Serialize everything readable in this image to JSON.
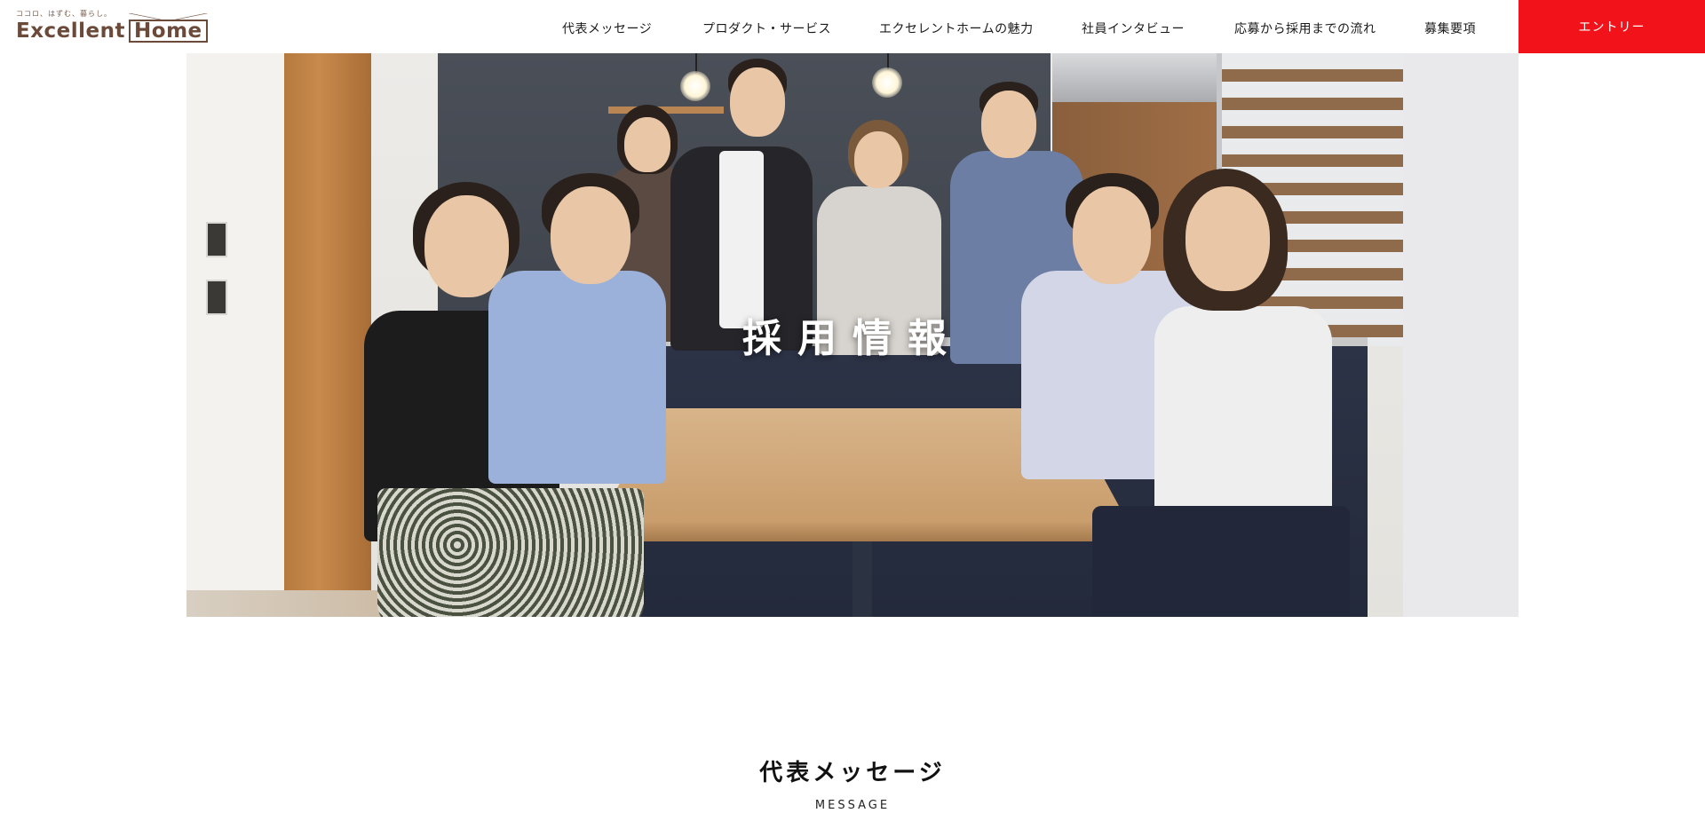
{
  "header": {
    "logo_tagline": "ココロ、はずむ、暮らし。",
    "logo_word1": "Excellent",
    "logo_word2": "Home",
    "nav": [
      {
        "label": "代表メッセージ"
      },
      {
        "label": "プロダクト・サービス"
      },
      {
        "label": "エクセレントホームの魅力"
      },
      {
        "label": "社員インタビュー"
      },
      {
        "label": "応募から採用までの流れ"
      },
      {
        "label": "募集要項"
      }
    ],
    "entry_label": "エントリー"
  },
  "hero": {
    "title": "採用情報"
  },
  "section": {
    "title": "代表メッセージ",
    "subtitle": "MESSAGE"
  },
  "colors": {
    "accent": "#f2131a",
    "logo": "#6b4a3a"
  }
}
